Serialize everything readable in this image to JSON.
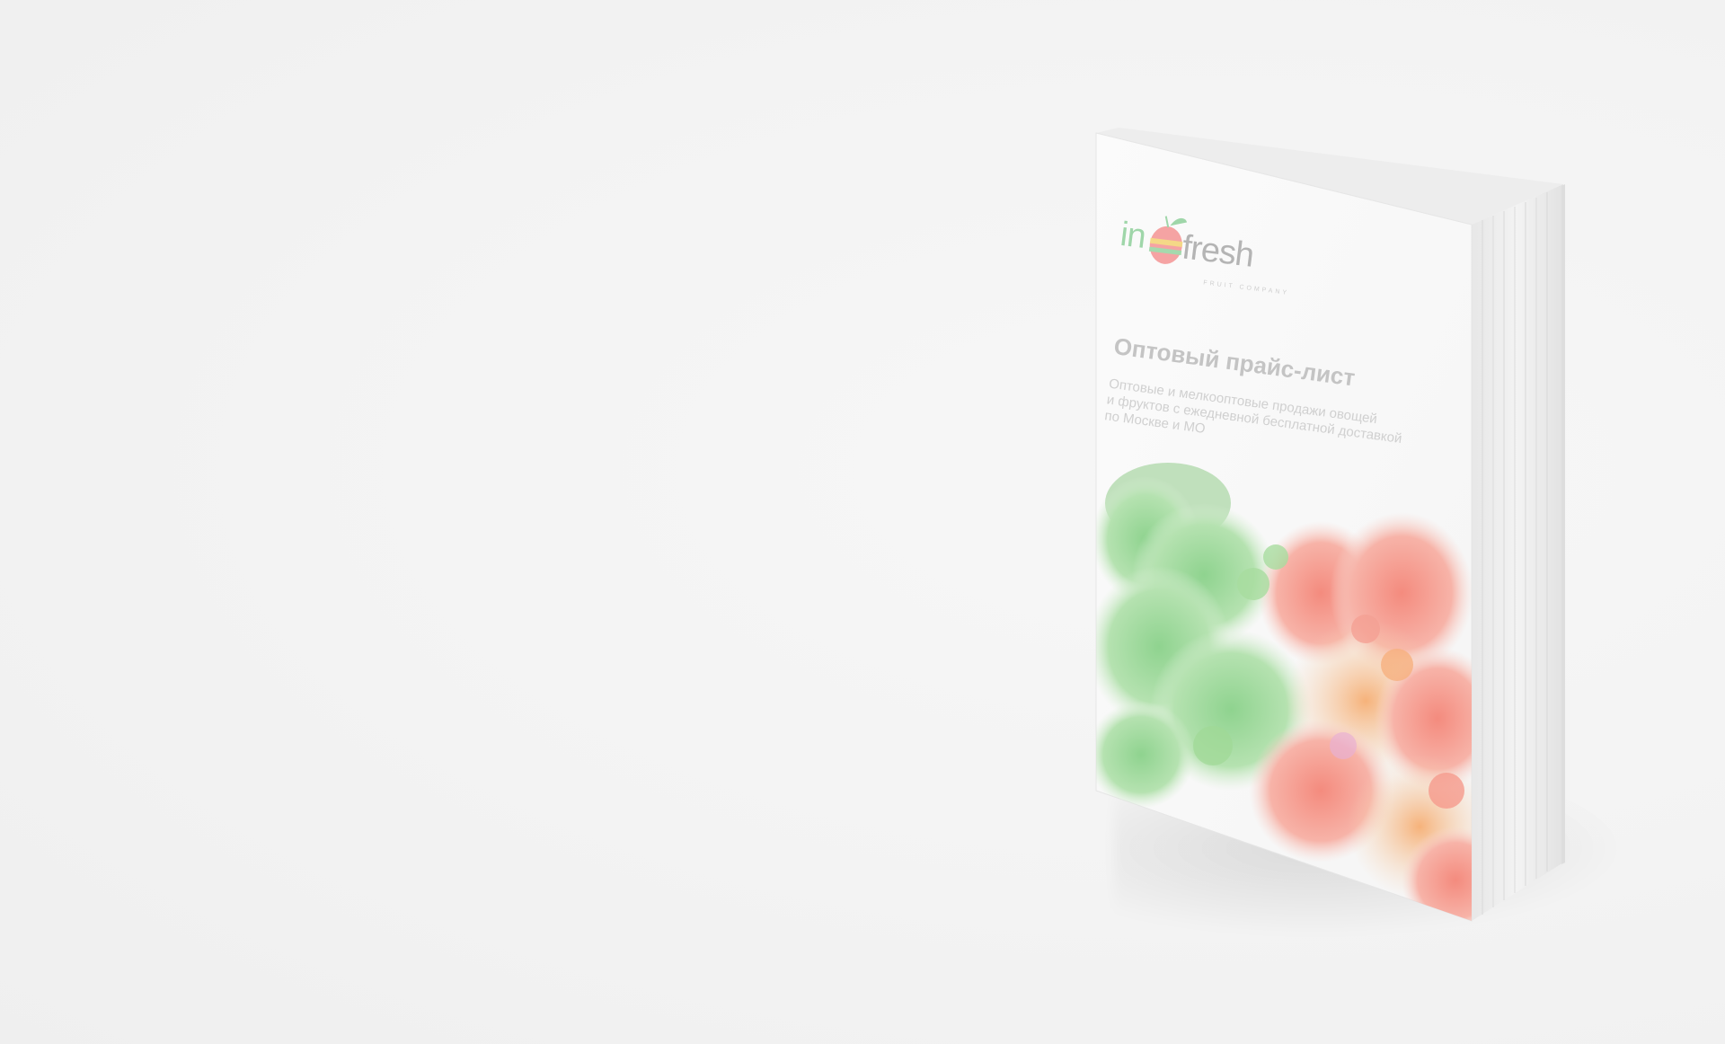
{
  "brand": {
    "logo_in": "in",
    "logo_fresh": "fresh",
    "logo_tagline": "FRUIT COMPANY",
    "colors": {
      "green": "#9fd6a9",
      "red": "#f09a9a",
      "yellow": "#f2d37a",
      "gray": "#b4b4b4"
    }
  },
  "cover": {
    "title": "Оптовый прайс-лист",
    "subtitle_lines": [
      "Оптовые и мелкооптовые продажи овощей",
      "и фруктов с ежедневной бесплатной доставкой",
      "по Москве и МО"
    ],
    "image": "vegetables-and-fruits-photo"
  },
  "background_color": "#f4f4f4"
}
